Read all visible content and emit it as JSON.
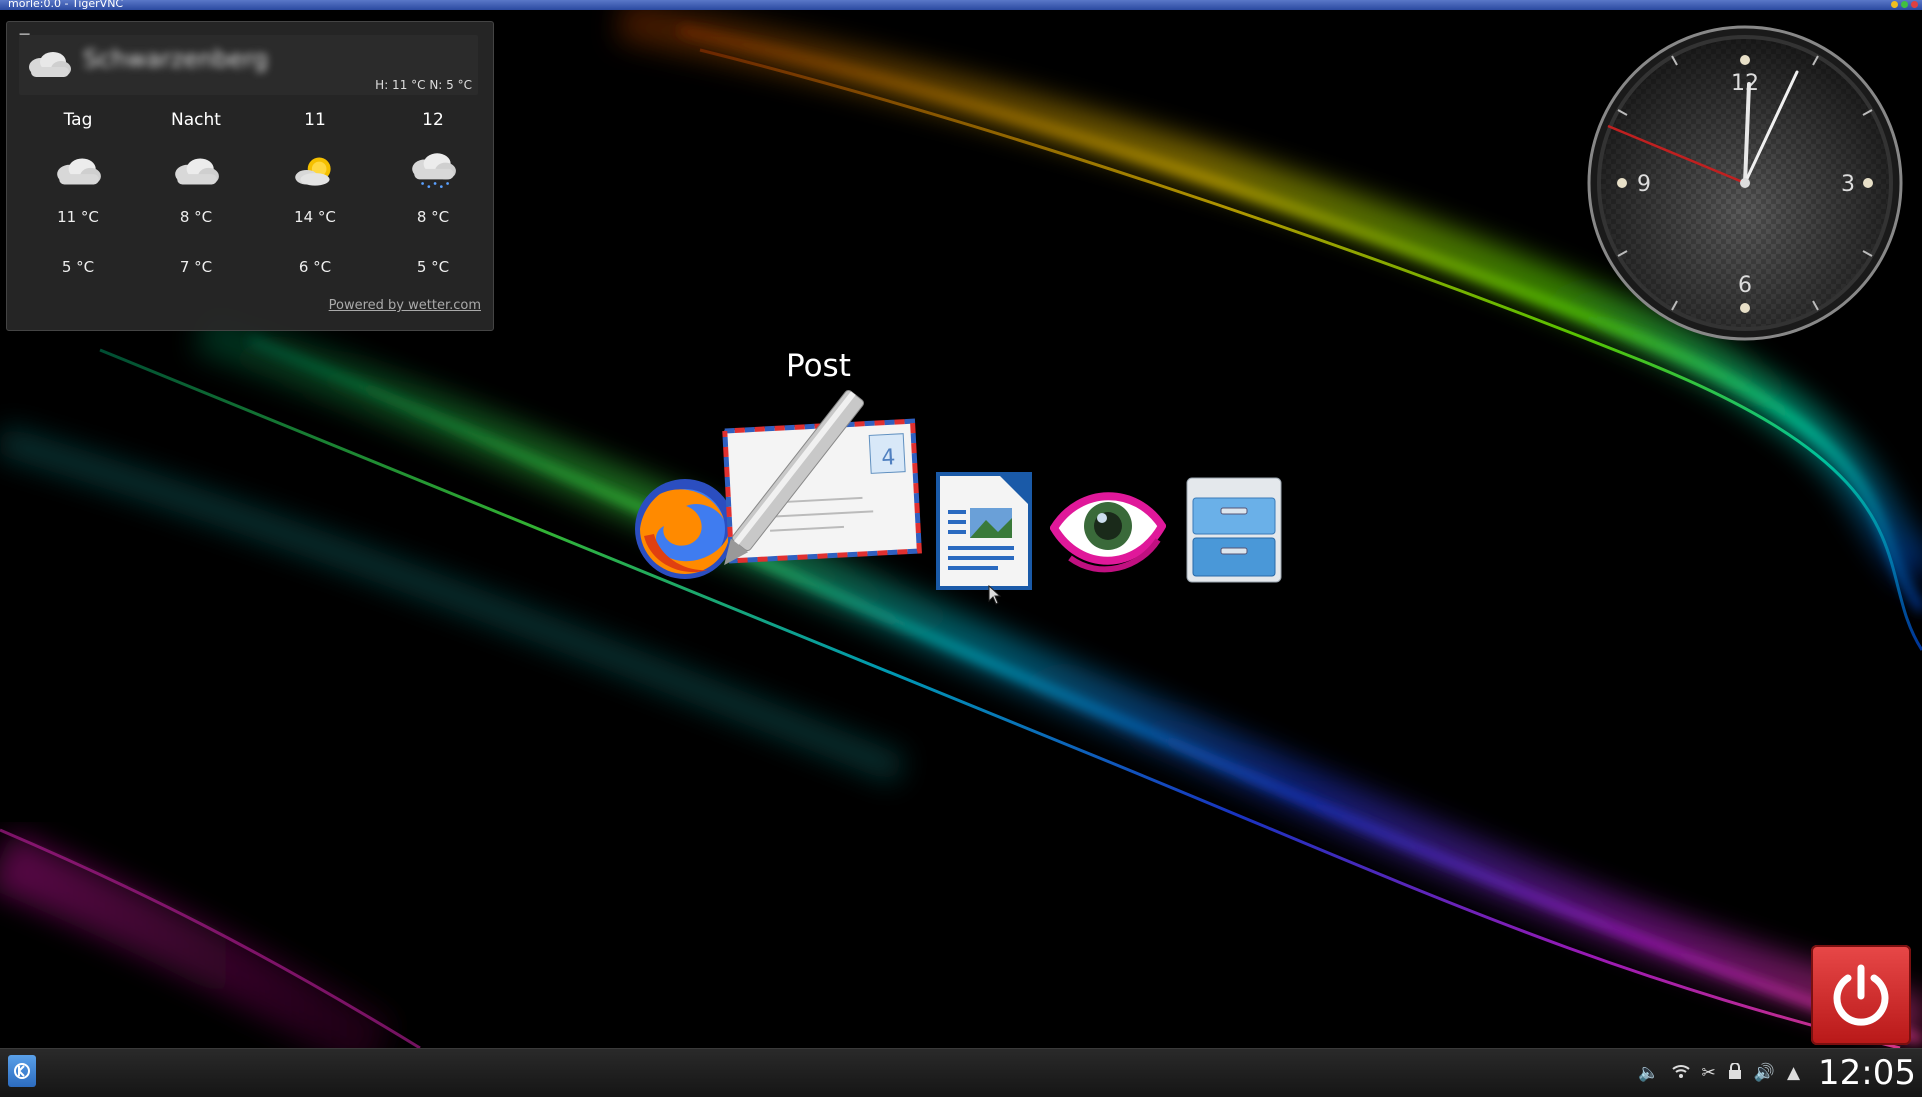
{
  "window": {
    "title": "morle:0.0 - TigerVNC",
    "buttons": [
      {
        "name": "minimize",
        "color": "#f0c020"
      },
      {
        "name": "maximize",
        "color": "#40c040"
      },
      {
        "name": "close",
        "color": "#e04040"
      }
    ]
  },
  "weather": {
    "menu_icon": "hamburger-icon",
    "location": "Schwarzenberg",
    "today_high_low": "H: 11 °C N: 5 °C",
    "forecast": [
      {
        "label": "Tag",
        "icon": "cloudy-icon",
        "high": "11 °C",
        "low": "5 °C"
      },
      {
        "label": "Nacht",
        "icon": "cloudy-icon",
        "high": "8 °C",
        "low": "7 °C"
      },
      {
        "label": "11",
        "icon": "partly-sunny-icon",
        "high": "14 °C",
        "low": "6 °C"
      },
      {
        "label": "12",
        "icon": "rain-cloud-icon",
        "high": "8 °C",
        "low": "5 °C"
      }
    ],
    "powered_by": "Powered by wetter.com"
  },
  "clock": {
    "numerals": [
      "12",
      "3",
      "6",
      "9"
    ],
    "time": "12:05"
  },
  "dock": {
    "hover_label": "Post",
    "items": [
      {
        "name": "firefox",
        "icon": "firefox-icon"
      },
      {
        "name": "mail",
        "icon": "mail-icon"
      },
      {
        "name": "writer",
        "icon": "document-icon"
      },
      {
        "name": "image-viewer",
        "icon": "eye-icon"
      },
      {
        "name": "file-manager",
        "icon": "file-cabinet-icon"
      }
    ]
  },
  "power": {
    "icon": "power-icon"
  },
  "taskbar": {
    "start_icon": "kde-icon",
    "tray_icons": [
      "speaker-icon",
      "wifi-icon",
      "scissors-icon",
      "lock-icon",
      "volume-icon",
      "expand-arrow-icon"
    ],
    "clock": "12:05"
  }
}
